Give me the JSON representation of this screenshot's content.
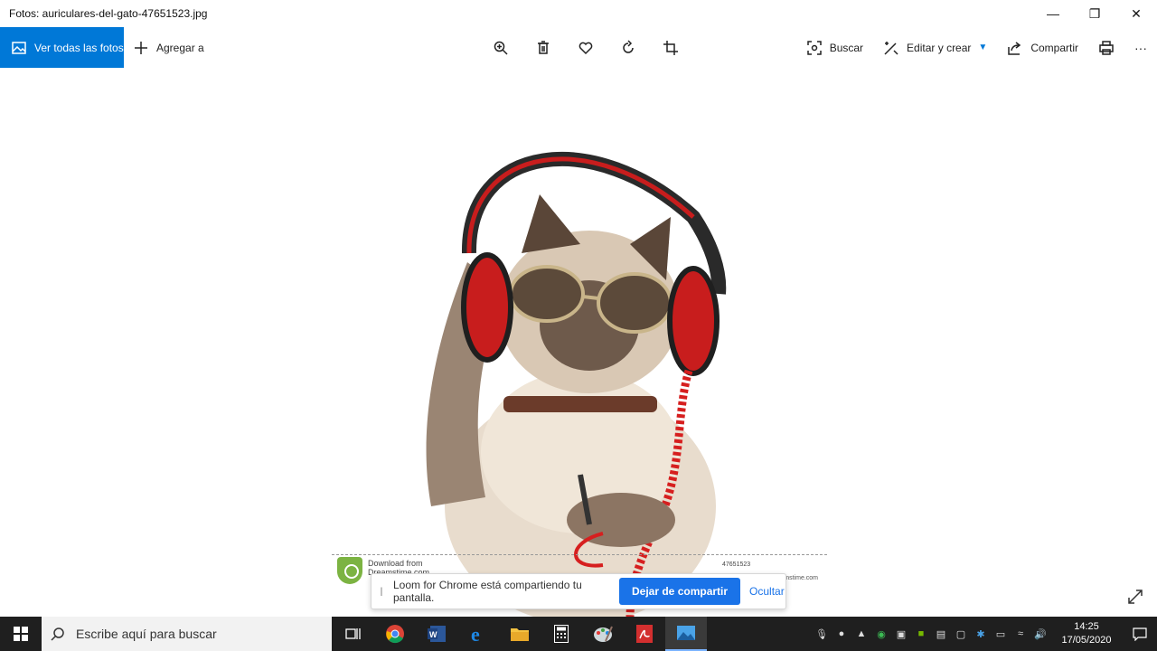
{
  "window": {
    "title": "Fotos: auriculares-del-gato-47651523.jpg",
    "minimize_glyph": "—",
    "restore_glyph": "❐",
    "close_glyph": "✕"
  },
  "toolbar": {
    "view_all_label": "Ver todas las fotos",
    "add_to_label": "Agregar a",
    "search_label": "Buscar",
    "edit_create_label": "Editar y crear",
    "share_label": "Compartir",
    "more_glyph": "···"
  },
  "image": {
    "credit_download": "Download from",
    "credit_brand": "Dreamstime.com",
    "credit_id": "47651523",
    "credit_site": "dreamstime.com"
  },
  "loom_banner": {
    "message": "Loom for Chrome está compartiendo tu pantalla.",
    "stop_label": "Dejar de compartir",
    "hide_label": "Ocultar"
  },
  "taskbar": {
    "search_placeholder": "Escribe aquí para buscar",
    "time": "14:25",
    "date": "17/05/2020"
  },
  "colors": {
    "accent": "#0078d7",
    "loom_blue": "#1a73e8",
    "taskbar_bg": "#1f1f1f"
  }
}
